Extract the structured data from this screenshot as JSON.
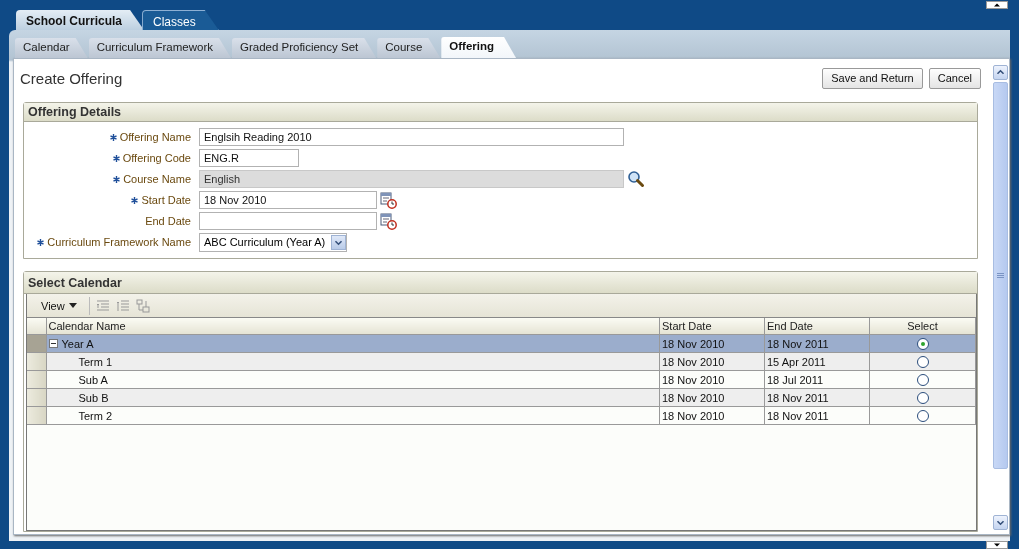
{
  "main_tabs": [
    {
      "label": "School Curricula",
      "selected": true
    },
    {
      "label": "Classes",
      "selected": false
    }
  ],
  "sub_tabs": [
    {
      "label": "Calendar",
      "selected": false
    },
    {
      "label": "Curriculum Framework",
      "selected": false
    },
    {
      "label": "Graded Proficiency Set",
      "selected": false
    },
    {
      "label": "Course",
      "selected": false
    },
    {
      "label": "Offering",
      "selected": true
    }
  ],
  "page_title": "Create Offering",
  "buttons": [
    "Save and Return",
    "Cancel"
  ],
  "offering_details": {
    "title": "Offering Details",
    "fields": [
      {
        "label": "Offering Name",
        "required": true,
        "disabled": false,
        "kind": "text",
        "value": "Englsih Reading 2010"
      },
      {
        "label": "Offering Code",
        "required": true,
        "disabled": false,
        "kind": "text",
        "value": "ENG.R"
      },
      {
        "label": "Course Name",
        "required": true,
        "disabled": true,
        "kind": "lookup",
        "value": "English"
      },
      {
        "label": "Start Date",
        "required": true,
        "disabled": false,
        "kind": "date",
        "value": "18 Nov 2010"
      },
      {
        "label": "End Date",
        "required": false,
        "disabled": false,
        "kind": "date"
      },
      {
        "label": "Curriculum Framework Name",
        "required": true,
        "disabled": false,
        "kind": "select",
        "value": "ABC Curriculum (Year A)"
      }
    ]
  },
  "calendar": {
    "title": "Select Calendar",
    "view_menu": "View",
    "columns": [
      "Calendar Name",
      "Start Date",
      "End Date",
      "Select"
    ],
    "rows": [
      {
        "name": "Year A",
        "start_date": "18 Nov 2010",
        "end_date": "18 Nov 2011",
        "selected": true,
        "expanded": true,
        "children": [
          {
            "name": "Term 1",
            "start_date": "18 Nov 2010",
            "end_date": "15 Apr 2011",
            "selected": false
          },
          {
            "name": "Sub A",
            "start_date": "18 Nov 2010",
            "end_date": "18 Jul 2011",
            "selected": false
          },
          {
            "name": "Sub B",
            "start_date": "18 Nov 2010",
            "end_date": "18 Nov 2011",
            "selected": false
          },
          {
            "name": "Term 2",
            "start_date": "18 Nov 2010",
            "end_date": "18 Nov 2011",
            "selected": false
          }
        ]
      }
    ]
  }
}
